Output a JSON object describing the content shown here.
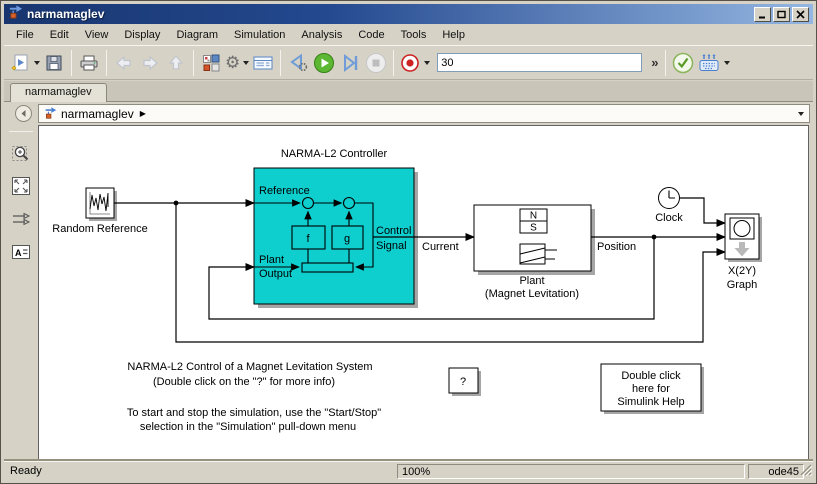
{
  "window": {
    "title": "narmamaglev"
  },
  "menu": {
    "items": [
      "File",
      "Edit",
      "View",
      "Display",
      "Diagram",
      "Simulation",
      "Analysis",
      "Code",
      "Tools",
      "Help"
    ]
  },
  "toolbar": {
    "stop_time": "30",
    "overflow": "»"
  },
  "tabs": {
    "active": "narmamaglev"
  },
  "breadcrumb": {
    "model": "narmamaglev"
  },
  "icons": {
    "gear": "⚙",
    "breadcrumb_arrow": "▶"
  },
  "diagram": {
    "controller_title": "NARMA-L2 Controller",
    "reference": "Reference",
    "plant_lbl": "Plant",
    "output_lbl": "Output",
    "control_lbl": "Control",
    "signal_lbl": "Signal",
    "f": "f",
    "g": "g",
    "random_reference": "Random Reference",
    "current": "Current",
    "position": "Position",
    "plant_name": "Plant",
    "plant_sub": "(Magnet Levitation)",
    "magnet_n": "N",
    "magnet_s": "S",
    "clock": "Clock",
    "xy1": "X(2Y)",
    "xy2": "Graph",
    "qmark": "?",
    "help1": "Double click",
    "help2": "here for",
    "help3": "Simulink Help",
    "ann1a": "NARMA-L2 Control of a Magnet Levitation System",
    "ann1b": "(Double click on the \"?\" for more info)",
    "ann2a": "To start and stop the simulation, use the \"Start/Stop\"",
    "ann2b": "selection in the \"Simulation\" pull-down menu"
  },
  "statusbar": {
    "status": "Ready",
    "zoom": "100%",
    "solver": "ode45"
  },
  "colors": {
    "block_cyan": "#0ecece",
    "titlebar_left": "#18356f",
    "run_green": "#5cb832",
    "record_red": "#cc2222"
  }
}
